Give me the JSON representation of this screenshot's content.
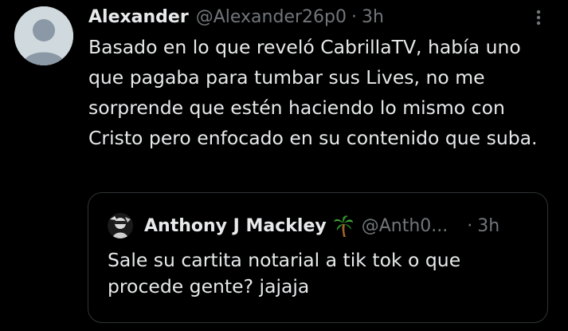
{
  "tweet": {
    "author_name": "Alexander",
    "author_handle": "@Alexander26p0",
    "separator": "·",
    "time": "3h",
    "avatar_icon": "default-profile-icon",
    "more_icon": "more-dots-icon",
    "text": "Basado en lo que reveló CabrillaTV, había uno que pagaba para tumbar sus Lives, no me sorprende que estén haciendo lo mismo con Cristo pero enfocado en su contenido que suba."
  },
  "quoted_tweet": {
    "author_name": "Anthony J Mackley",
    "author_emoji": "🌴",
    "author_handle": "@Anth0...",
    "separator": "·",
    "time": "3h",
    "text": "Sale su cartita notarial a tik tok o que procede gente? jajaja"
  },
  "colors": {
    "background": "#000000",
    "text_primary": "#e7e9ea",
    "text_secondary": "#71767b",
    "border": "#2f3336",
    "avatar_bg": "#cfd9de"
  }
}
